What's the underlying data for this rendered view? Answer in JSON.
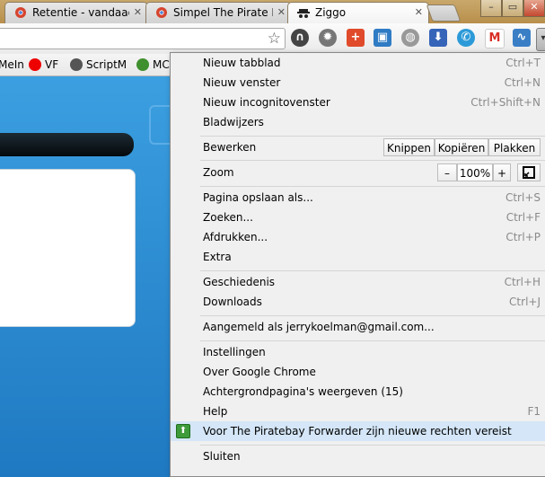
{
  "tabs": [
    {
      "title": "Retentie - vandaag g",
      "close": "✕"
    },
    {
      "title": "Simpel The Pirate Ba",
      "close": "✕"
    },
    {
      "title": "Ziggo",
      "close": "✕"
    }
  ],
  "window_buttons": {
    "minimize": "–",
    "maximize": "▭",
    "close": "✕"
  },
  "bookmarks": [
    {
      "label": "MeIn"
    },
    {
      "label": "VF"
    },
    {
      "label": "ScriptM"
    },
    {
      "label": "MC"
    }
  ],
  "menu": {
    "new_tab": {
      "label": "Nieuw tabblad",
      "shortcut": "Ctrl+T"
    },
    "new_window": {
      "label": "Nieuw venster",
      "shortcut": "Ctrl+N"
    },
    "new_incognito": {
      "label": "Nieuw incognitovenster",
      "shortcut": "Ctrl+Shift+N"
    },
    "bookmarks": {
      "label": "Bladwijzers"
    },
    "edit": {
      "label": "Bewerken",
      "cut": "Knippen",
      "copy": "Kopiëren",
      "paste": "Plakken"
    },
    "zoom": {
      "label": "Zoom",
      "minus": "–",
      "value": "100%",
      "plus": "+"
    },
    "save_page": {
      "label": "Pagina opslaan als...",
      "shortcut": "Ctrl+S"
    },
    "find": {
      "label": "Zoeken...",
      "shortcut": "Ctrl+F"
    },
    "print": {
      "label": "Afdrukken...",
      "shortcut": "Ctrl+P"
    },
    "extra": {
      "label": "Extra"
    },
    "history": {
      "label": "Geschiedenis",
      "shortcut": "Ctrl+H"
    },
    "downloads": {
      "label": "Downloads",
      "shortcut": "Ctrl+J"
    },
    "signed_in": {
      "label": "Aangemeld als jerrykoelman@gmail.com..."
    },
    "settings": {
      "label": "Instellingen"
    },
    "about": {
      "label": "Over Google Chrome"
    },
    "background_pages": {
      "label": "Achtergrondpagina's weergeven (15)"
    },
    "help": {
      "label": "Help",
      "shortcut": "F1"
    },
    "extension_notice": {
      "label": "Voor The Piratebay Forwarder zijn nieuwe rechten vereist"
    },
    "exit": {
      "label": "Sluiten"
    }
  },
  "colors": {
    "page_blue": "#2d8ad1",
    "menu_bg": "#f0f0f0",
    "highlight": "#d4e6f7",
    "titlebar": "#c9a86c"
  }
}
